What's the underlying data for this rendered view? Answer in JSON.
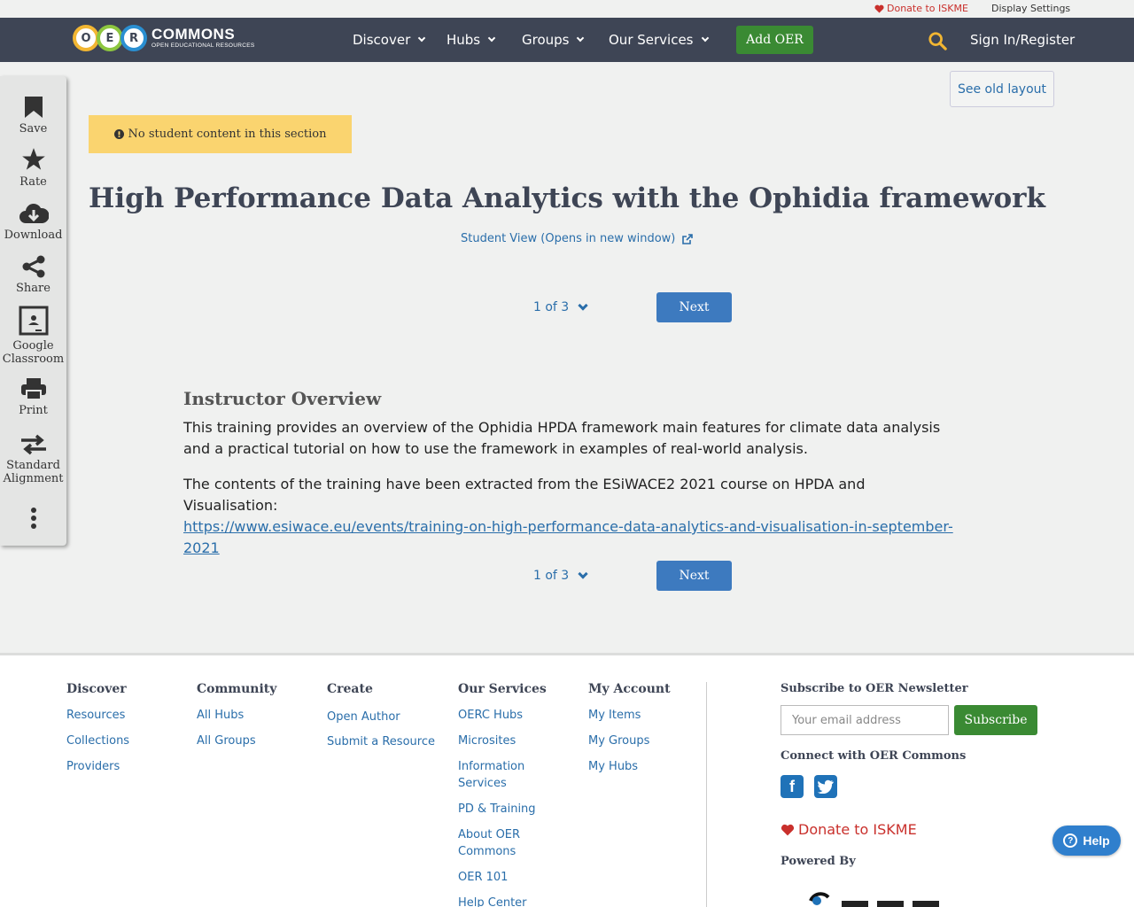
{
  "utility_bar": {
    "donate": "Donate to ISKME",
    "display_settings": "Display Settings"
  },
  "navbar": {
    "logo_letters": [
      "O",
      "E",
      "R"
    ],
    "logo_word": "COMMONS",
    "logo_tagline": "OPEN EDUCATIONAL RESOURCES",
    "items": [
      {
        "label": "Discover"
      },
      {
        "label": "Hubs"
      },
      {
        "label": "Groups"
      },
      {
        "label": "Our Services"
      }
    ],
    "add_oer": "Add OER",
    "sign_in": "Sign In/Register"
  },
  "sidebar": {
    "save": "Save",
    "rate": "Rate",
    "download": "Download",
    "share": "Share",
    "google_classroom_1": "Google",
    "google_classroom_2": "Classroom",
    "print": "Print",
    "alignment_1": "Standard",
    "alignment_2": "Alignment"
  },
  "content": {
    "see_old_layout": "See old layout",
    "alert": "No student content in this section",
    "title": "High Performance Data Analytics with the Ophidia framework",
    "student_view": "Student View (Opens in new window)",
    "pager": "1 of 3",
    "next": "Next",
    "overview_heading": "Instructor Overview",
    "para1": "This training provides an overview of the Ophidia HPDA framework main features for climate data analysis and a practical tutorial on how to use the framework in examples of real-world analysis.",
    "para2": "The contents of the training have been extracted from the ESiWACE2 2021 course on HPDA and Visualisation:",
    "para2_link": "https://www.esiwace.eu/events/training-on-high-performance-data-analytics-and-visualisation-in-september-2021"
  },
  "footer": {
    "discover": {
      "heading": "Discover",
      "links": [
        "Resources",
        "Collections",
        "Providers"
      ]
    },
    "community": {
      "heading": "Community",
      "links": [
        "All Hubs",
        "All Groups"
      ]
    },
    "create": {
      "heading": "Create",
      "links": [
        "Open Author",
        "Submit a Resource"
      ]
    },
    "services": {
      "heading": "Our Services",
      "links": [
        "OERC Hubs",
        "Microsites",
        "Information Services",
        "PD & Training",
        "About OER Commons",
        "OER 101",
        "Help Center"
      ]
    },
    "account": {
      "heading": "My Account",
      "links": [
        "My Items",
        "My Groups",
        "My Hubs"
      ]
    },
    "newsletter_heading": "Subscribe to OER Newsletter",
    "email_placeholder": "Your email address",
    "subscribe": "Subscribe",
    "connect_heading": "Connect with OER Commons",
    "donate": "Donate to ISKME",
    "powered_by": "Powered By",
    "help": "Help"
  },
  "colors": {
    "navbar_bg": "#3e4555",
    "accent_green": "#3a8a33",
    "link_blue": "#2a6eaa",
    "alert_yellow": "#fad46f",
    "donate_red": "#c9302c"
  }
}
